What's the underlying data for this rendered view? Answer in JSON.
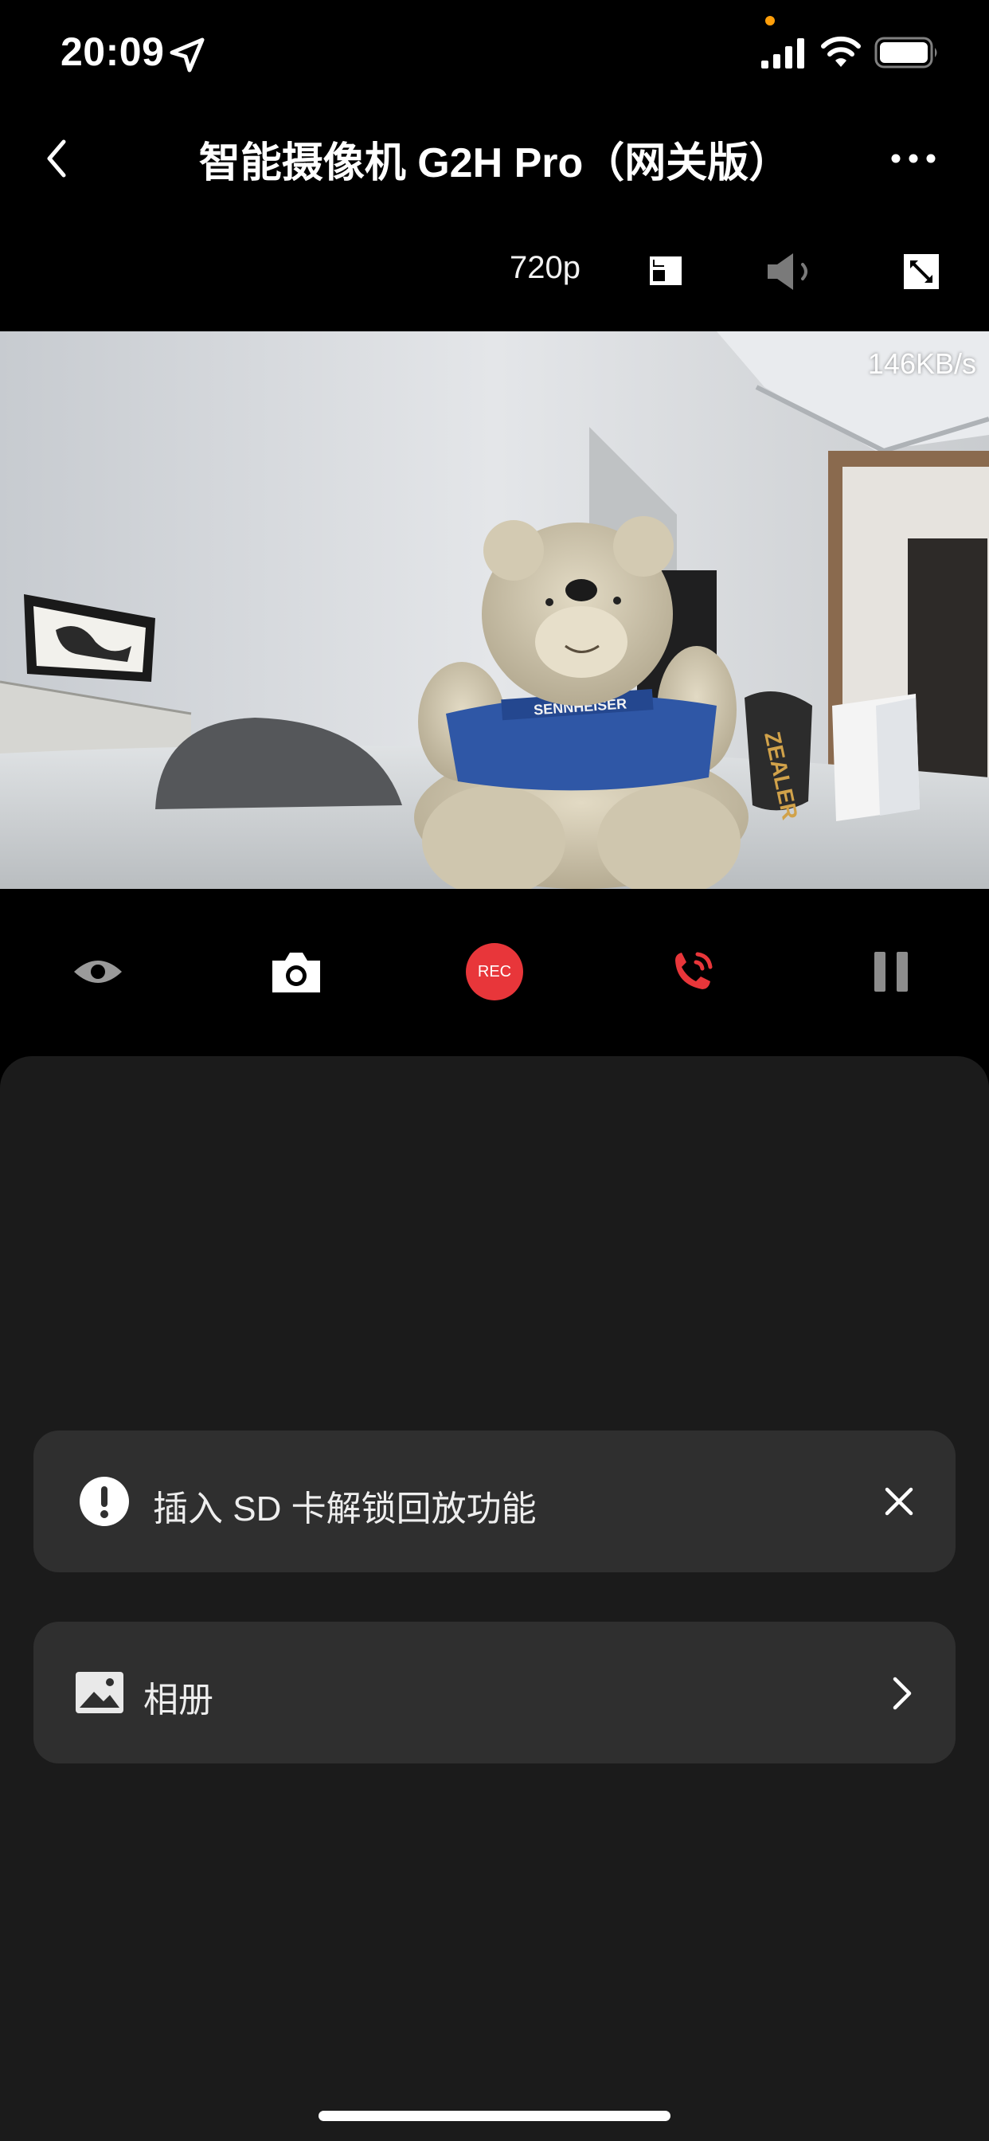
{
  "status_bar": {
    "time": "20:09",
    "indicator_color": "#ff9f0a"
  },
  "nav": {
    "title": "智能摄像机 G2H Pro（网关版）",
    "back_icon": "chevron-left-icon",
    "more_icon": "more-horizontal-icon"
  },
  "toolbar": {
    "quality": "720p"
  },
  "video": {
    "bitrate": "146KB/s",
    "shirt_text": "SENNHEISER",
    "box_text": "ZEALER"
  },
  "controls": {
    "rec_label": "REC",
    "accent_color": "#e8363a"
  },
  "sd_card_banner": {
    "text": "插入 SD 卡解锁回放功能"
  },
  "album": {
    "label": "相册"
  }
}
